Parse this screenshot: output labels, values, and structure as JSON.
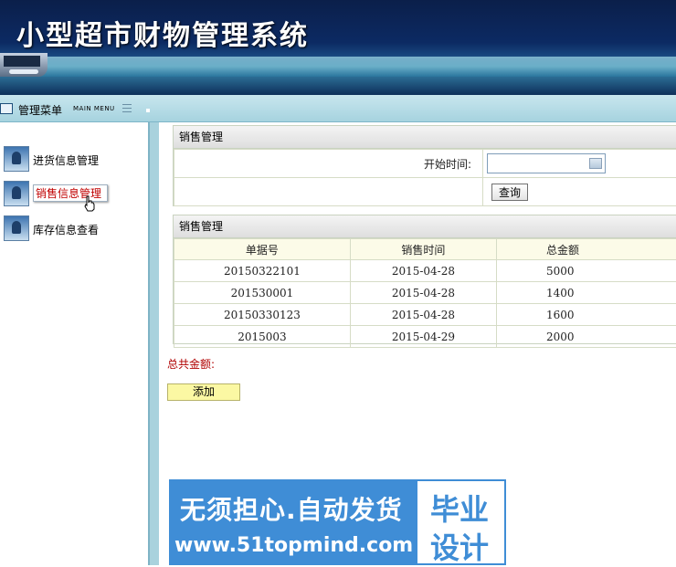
{
  "app": {
    "title": "小型超市财物管理系统"
  },
  "menubar": {
    "title": "管理菜单",
    "subtitle": "MAIN MENU"
  },
  "sidebar": {
    "items": [
      {
        "label": "进货信息管理",
        "active": false
      },
      {
        "label": "销售信息管理",
        "active": true
      },
      {
        "label": "库存信息查看",
        "active": false
      }
    ]
  },
  "search": {
    "panel_title": "销售管理",
    "start_time_label": "开始时间:",
    "start_time_value": "",
    "query_button": "查询"
  },
  "list": {
    "panel_title": "销售管理",
    "columns": [
      "单据号",
      "销售时间",
      "总金额"
    ],
    "rows": [
      [
        "20150322101",
        "2015-04-28",
        "5000"
      ],
      [
        "201530001",
        "2015-04-28",
        "1400"
      ],
      [
        "20150330123",
        "2015-04-28",
        "1600"
      ],
      [
        "2015003",
        "2015-04-29",
        "2000"
      ]
    ]
  },
  "footer": {
    "total_label": "总共金额:",
    "add_button": "添加"
  },
  "watermark": {
    "line1": "无须担心.自动发货",
    "line2": "www.51topmind.com",
    "box_line1": "毕业",
    "box_line2": "设计"
  }
}
